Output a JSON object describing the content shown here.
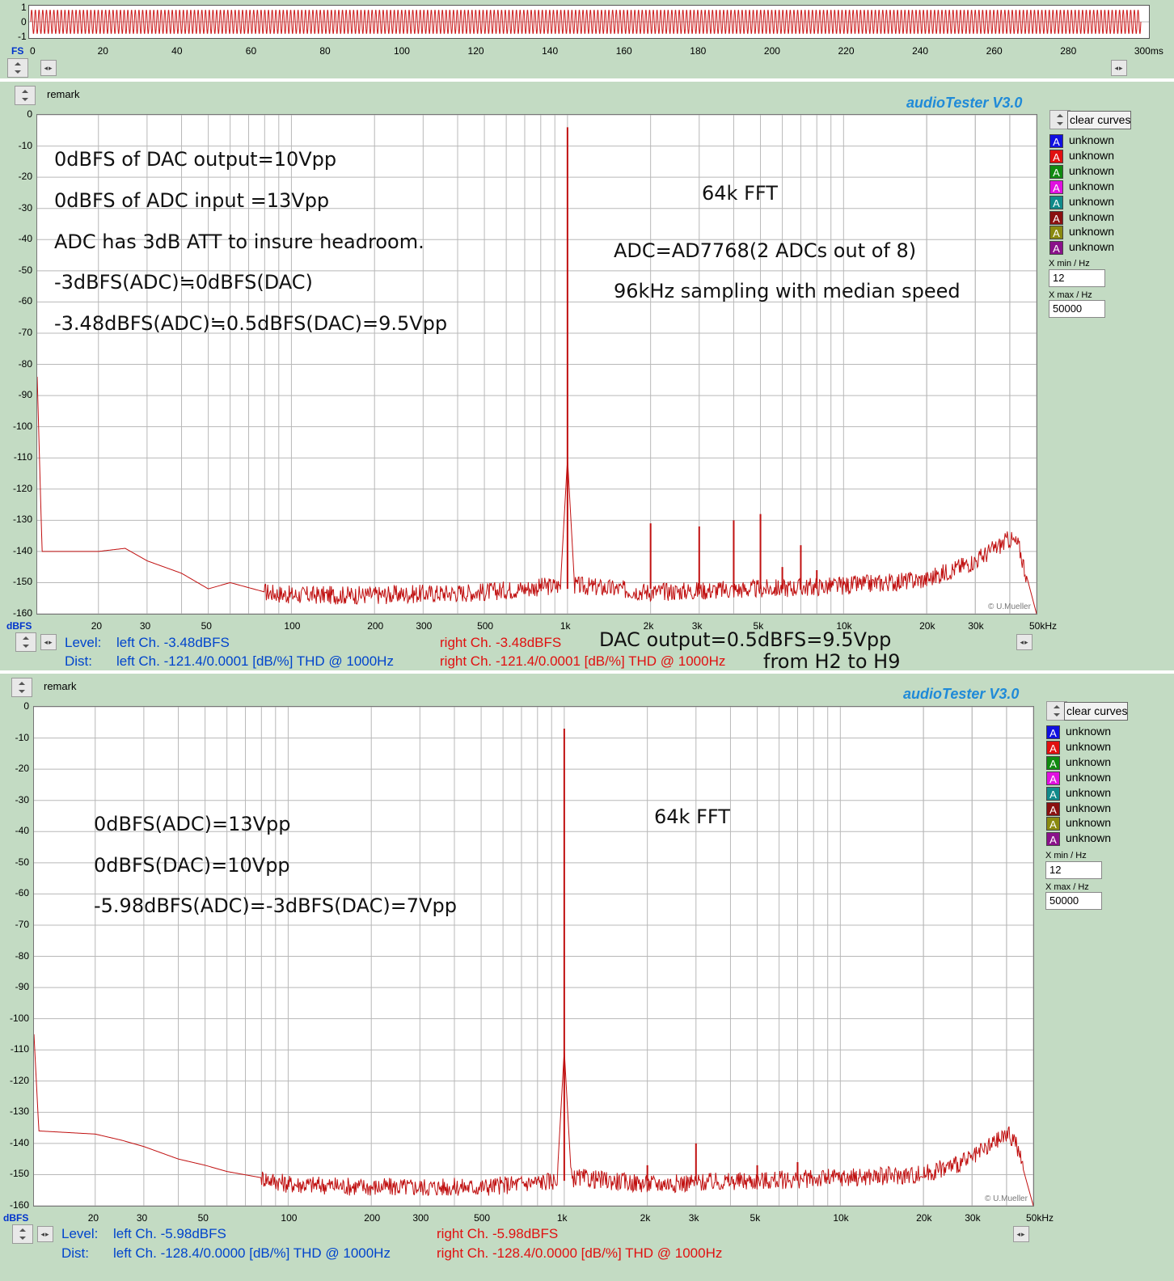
{
  "scope": {
    "y_ticks": [
      "1",
      "0",
      "-1"
    ],
    "unit_left": "FS",
    "x_ticks": [
      "0",
      "20",
      "40",
      "60",
      "80",
      "100",
      "120",
      "140",
      "160",
      "180",
      "200",
      "220",
      "240",
      "260",
      "280",
      "300ms"
    ]
  },
  "panels": [
    {
      "remark": "remark",
      "app_title": "audioTester  V3.0",
      "clear_button": "clear curves",
      "curves": [
        {
          "label": "unknown",
          "color": "#1010e0"
        },
        {
          "label": "unknown",
          "color": "#e01010"
        },
        {
          "label": "unknown",
          "color": "#108a10"
        },
        {
          "label": "unknown",
          "color": "#e010e0"
        },
        {
          "label": "unknown",
          "color": "#108a8a"
        },
        {
          "label": "unknown",
          "color": "#8a1010"
        },
        {
          "label": "unknown",
          "color": "#8a8a10"
        },
        {
          "label": "unknown",
          "color": "#8a108a"
        }
      ],
      "xmin_label": "X min / Hz",
      "xmin_value": "12",
      "xmax_label": "X max / Hz",
      "xmax_value": "50000",
      "annotations": [
        "0dBFS of DAC output=10Vpp",
        "0dBFS of ADC input  =13Vpp",
        "ADC has 3dB ATT to insure headroom.",
        "-3dBFS(ADC)≒0dBFS(DAC)",
        "-3.48dBFS(ADC)≒0.5dBFS(DAC)=9.5Vpp",
        "64k FFT",
        "ADC=AD7768(2 ADCs out of 8)",
        "96kHz sampling with median speed"
      ],
      "status": {
        "level_label": "Level:",
        "level_left": "left Ch. -3.48dBFS",
        "level_right": "right Ch. -3.48dBFS",
        "dist_label": "Dist:",
        "dist_left": "left Ch. -121.4/0.0001 [dB/%] THD @ 1000Hz",
        "dist_right": "right Ch. -121.4/0.0001 [dB/%] THD @ 1000Hz",
        "note1": "DAC output=0.5dBFS=9.5Vpp",
        "note2": "from H2 to H9"
      },
      "copyright": "© U.Mueller"
    },
    {
      "remark": "remark",
      "app_title": "audioTester  V3.0",
      "clear_button": "clear curves",
      "curves": [
        {
          "label": "unknown",
          "color": "#1010e0"
        },
        {
          "label": "unknown",
          "color": "#e01010"
        },
        {
          "label": "unknown",
          "color": "#108a10"
        },
        {
          "label": "unknown",
          "color": "#e010e0"
        },
        {
          "label": "unknown",
          "color": "#108a8a"
        },
        {
          "label": "unknown",
          "color": "#8a1010"
        },
        {
          "label": "unknown",
          "color": "#8a8a10"
        },
        {
          "label": "unknown",
          "color": "#8a108a"
        }
      ],
      "xmin_label": "X min / Hz",
      "xmin_value": "12",
      "xmax_label": "X max / Hz",
      "xmax_value": "50000",
      "annotations": [
        "0dBFS(ADC)=13Vpp",
        "0dBFS(DAC)=10Vpp",
        "-5.98dBFS(ADC)=-3dBFS(DAC)=7Vpp",
        "64k FFT"
      ],
      "status": {
        "level_label": "Level:",
        "level_left": "left Ch. -5.98dBFS",
        "level_right": "right Ch. -5.98dBFS",
        "dist_label": "Dist:",
        "dist_left": "left Ch. -128.4/0.0000 [dB/%] THD @ 1000Hz",
        "dist_right": "right Ch. -128.4/0.0000 [dB/%] THD @ 1000Hz"
      },
      "copyright": "© U.Mueller"
    }
  ],
  "spectrum_axis": {
    "y_ticks": [
      "0",
      "-10",
      "-20",
      "-30",
      "-40",
      "-50",
      "-60",
      "-70",
      "-80",
      "-90",
      "-100",
      "-110",
      "-120",
      "-130",
      "-140",
      "-150",
      "-160"
    ],
    "y_unit": "dBFS",
    "x_ticks": [
      "20",
      "30",
      "50",
      "100",
      "200",
      "300",
      "500",
      "1k",
      "2k",
      "3k",
      "5k",
      "10k",
      "20k",
      "30k",
      "50kHz"
    ]
  },
  "chart_data": [
    {
      "type": "line",
      "x_scale": "log",
      "xlim": [
        12,
        50000
      ],
      "ylim": [
        -160,
        0
      ],
      "color": "#c01010",
      "peaks": [
        {
          "x": 1000,
          "y": -4
        },
        {
          "x": 2000,
          "y": -131
        },
        {
          "x": 3000,
          "y": -132
        },
        {
          "x": 4000,
          "y": -130
        },
        {
          "x": 5000,
          "y": -128
        },
        {
          "x": 6000,
          "y": -145
        },
        {
          "x": 7000,
          "y": -138
        },
        {
          "x": 8000,
          "y": -146
        }
      ],
      "floor": [
        [
          12,
          -84
        ],
        [
          12.5,
          -140
        ],
        [
          20,
          -140
        ],
        [
          25,
          -139
        ],
        [
          30,
          -143
        ],
        [
          40,
          -147
        ],
        [
          50,
          -152
        ],
        [
          60,
          -150
        ],
        [
          80,
          -153
        ],
        [
          100,
          -154
        ],
        [
          200,
          -154
        ],
        [
          500,
          -153
        ],
        [
          900,
          -151
        ],
        [
          1100,
          -151
        ],
        [
          2000,
          -153
        ],
        [
          5000,
          -152
        ],
        [
          10000,
          -151
        ],
        [
          20000,
          -149
        ],
        [
          30000,
          -143
        ],
        [
          40000,
          -136
        ],
        [
          43000,
          -138
        ],
        [
          50000,
          -160
        ]
      ]
    },
    {
      "type": "line",
      "x_scale": "log",
      "xlim": [
        12,
        50000
      ],
      "ylim": [
        -160,
        0
      ],
      "color": "#c01010",
      "peaks": [
        {
          "x": 1000,
          "y": -7
        },
        {
          "x": 2000,
          "y": -147
        },
        {
          "x": 3000,
          "y": -140
        },
        {
          "x": 5000,
          "y": -147
        },
        {
          "x": 7000,
          "y": -146
        }
      ],
      "floor": [
        [
          12,
          -105
        ],
        [
          12.5,
          -136
        ],
        [
          20,
          -137
        ],
        [
          25,
          -139
        ],
        [
          30,
          -141
        ],
        [
          40,
          -145
        ],
        [
          50,
          -147
        ],
        [
          60,
          -149
        ],
        [
          80,
          -151
        ],
        [
          100,
          -153
        ],
        [
          200,
          -154
        ],
        [
          500,
          -154
        ],
        [
          900,
          -152
        ],
        [
          1100,
          -151
        ],
        [
          2000,
          -153
        ],
        [
          5000,
          -152
        ],
        [
          10000,
          -151
        ],
        [
          20000,
          -150
        ],
        [
          30000,
          -145
        ],
        [
          40000,
          -137
        ],
        [
          43000,
          -139
        ],
        [
          50000,
          -160
        ]
      ]
    }
  ]
}
